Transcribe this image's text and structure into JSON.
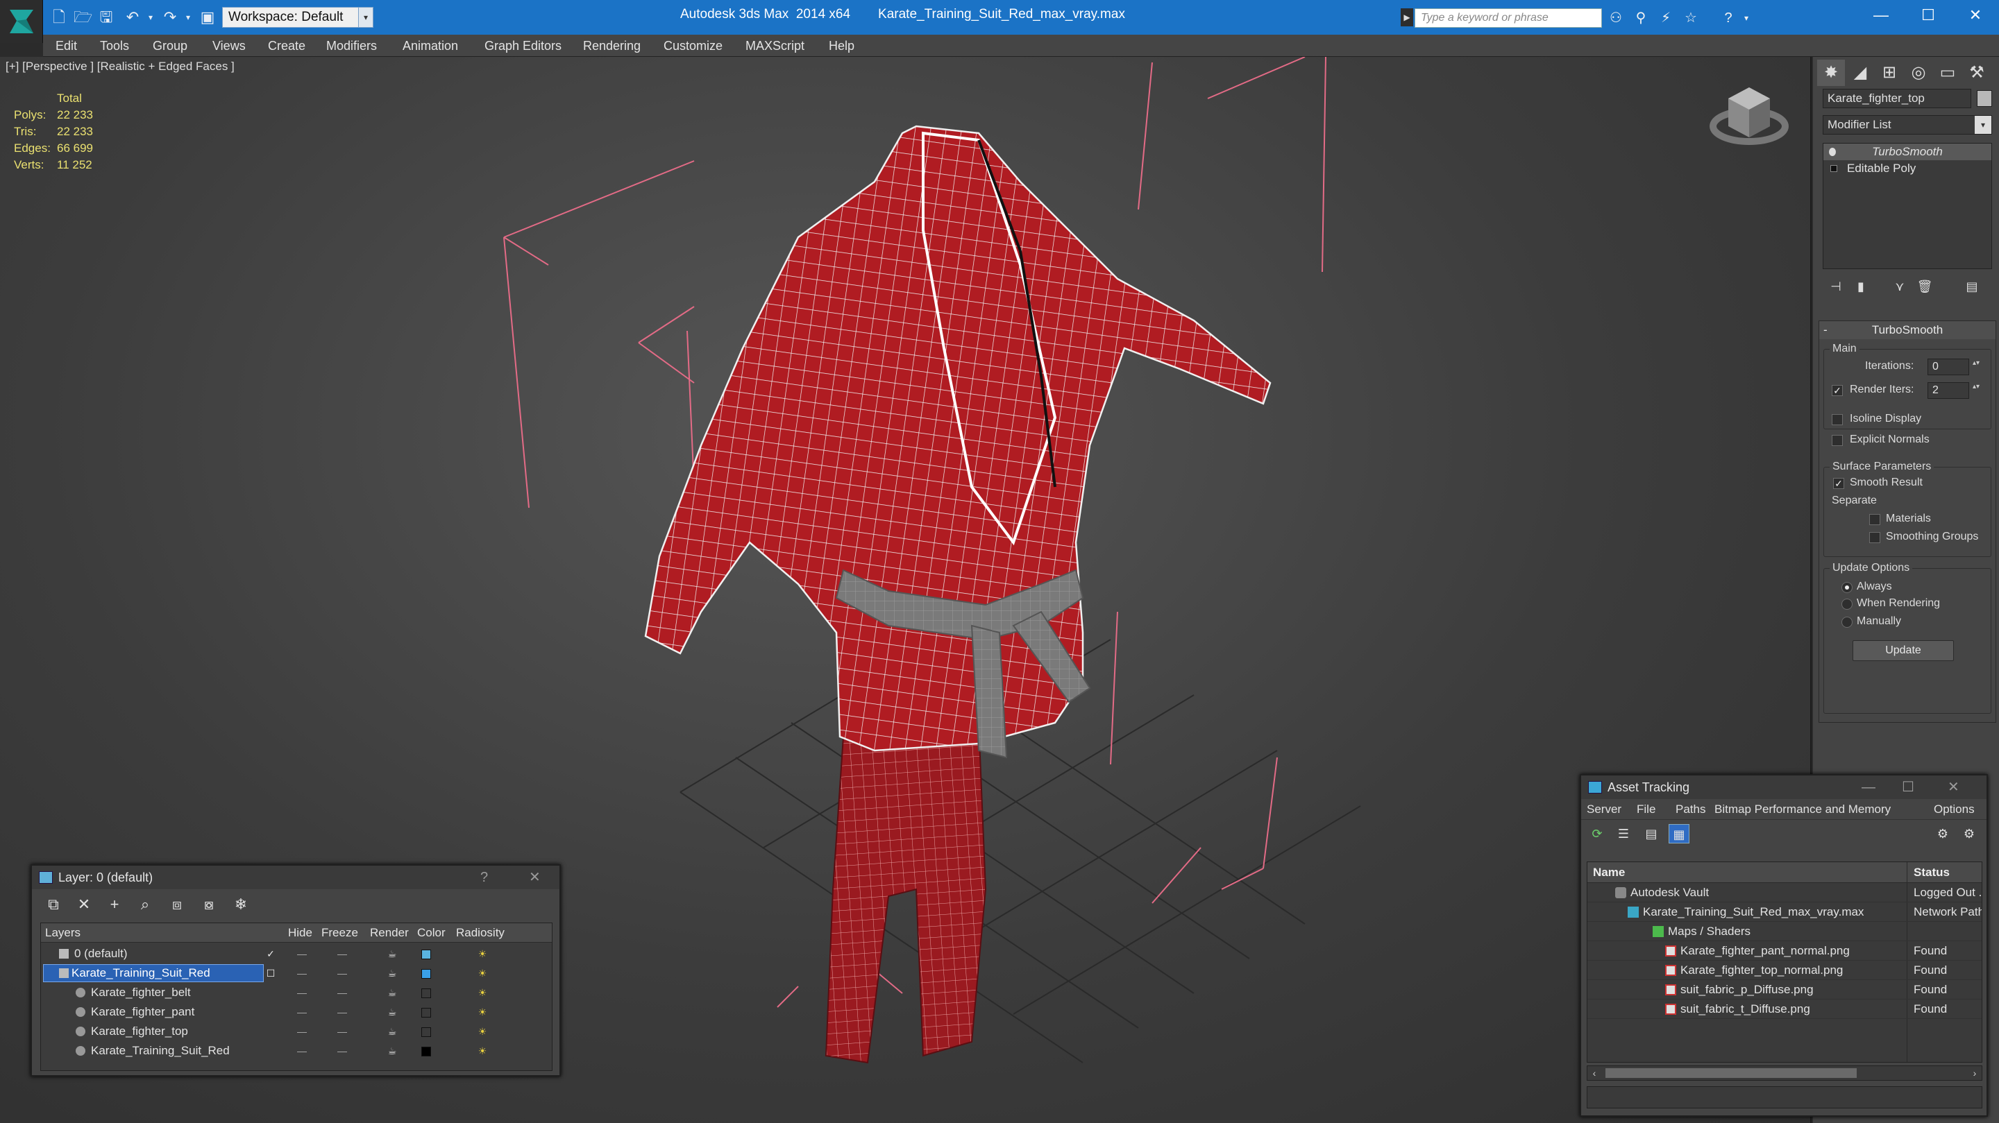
{
  "window": {
    "app_title": "Autodesk 3ds Max  2014 x64",
    "file_title": "Karate_Training_Suit_Red_max_vray.max",
    "workspace": "Workspace: Default",
    "search_placeholder": "Type a keyword or phrase"
  },
  "menu": [
    "Edit",
    "Tools",
    "Group",
    "Views",
    "Create",
    "Modifiers",
    "Animation",
    "Graph Editors",
    "Rendering",
    "Customize",
    "MAXScript",
    "Help"
  ],
  "viewport": {
    "label": "[+] [Perspective ] [Realistic + Edged Faces ]",
    "stats_header": "Total",
    "stats": [
      {
        "key": "Polys:",
        "value": "22 233"
      },
      {
        "key": "Tris:",
        "value": "22 233"
      },
      {
        "key": "Edges:",
        "value": "66 699"
      },
      {
        "key": "Verts:",
        "value": "11 252"
      }
    ]
  },
  "command_panel": {
    "object_name": "Karate_fighter_top",
    "modifier_list": "Modifier List",
    "stack": [
      "TurboSmooth",
      "Editable Poly"
    ],
    "rollout_title": "TurboSmooth",
    "main_group": "Main",
    "iterations_label": "Iterations:",
    "iterations_value": "0",
    "render_iters_label": "Render Iters:",
    "render_iters_value": "2",
    "isoline_label": "Isoline Display",
    "explicit_normals_label": "Explicit Normals",
    "surface_group": "Surface Parameters",
    "smooth_result_label": "Smooth Result",
    "separate_label": "Separate",
    "materials_label": "Materials",
    "smoothing_groups_label": "Smoothing Groups",
    "update_group": "Update Options",
    "always_label": "Always",
    "when_rendering_label": "When Rendering",
    "manually_label": "Manually",
    "update_button": "Update"
  },
  "layer_dialog": {
    "title": "Layer: 0 (default)",
    "help": "?",
    "close": "✕",
    "columns": [
      "Layers",
      "Hide",
      "Freeze",
      "Render",
      "Color",
      "Radiosity"
    ],
    "rows": [
      {
        "name": "0 (default)",
        "color": "#5ab4e0",
        "indent": 1
      },
      {
        "name": "Karate_Training_Suit_Red",
        "color": "#3aa0e8",
        "indent": 1
      },
      {
        "name": "Karate_fighter_belt",
        "color": "#3a3a3a",
        "indent": 2
      },
      {
        "name": "Karate_fighter_pant",
        "color": "#3a3a3a",
        "indent": 2
      },
      {
        "name": "Karate_fighter_top",
        "color": "#3a3a3a",
        "indent": 2
      },
      {
        "name": "Karate_Training_Suit_Red",
        "color": "#000000",
        "indent": 2
      }
    ]
  },
  "asset_dialog": {
    "title": "Asset Tracking",
    "menu": [
      "Server",
      "File",
      "Paths",
      "Bitmap Performance and Memory",
      "Options"
    ],
    "columns": [
      "Name",
      "Status"
    ],
    "rows": [
      {
        "name": "Autodesk Vault",
        "status": "Logged Out ...",
        "indent": 1
      },
      {
        "name": "Karate_Training_Suit_Red_max_vray.max",
        "status": "Network Path",
        "indent": 2
      },
      {
        "name": "Maps / Shaders",
        "status": "",
        "indent": 3
      },
      {
        "name": "Karate_fighter_pant_normal.png",
        "status": "Found",
        "indent": 4
      },
      {
        "name": "Karate_fighter_top_normal.png",
        "status": "Found",
        "indent": 4
      },
      {
        "name": "suit_fabric_p_Diffuse.png",
        "status": "Found",
        "indent": 4
      },
      {
        "name": "suit_fabric_t_Diffuse.png",
        "status": "Found",
        "indent": 4
      }
    ]
  }
}
